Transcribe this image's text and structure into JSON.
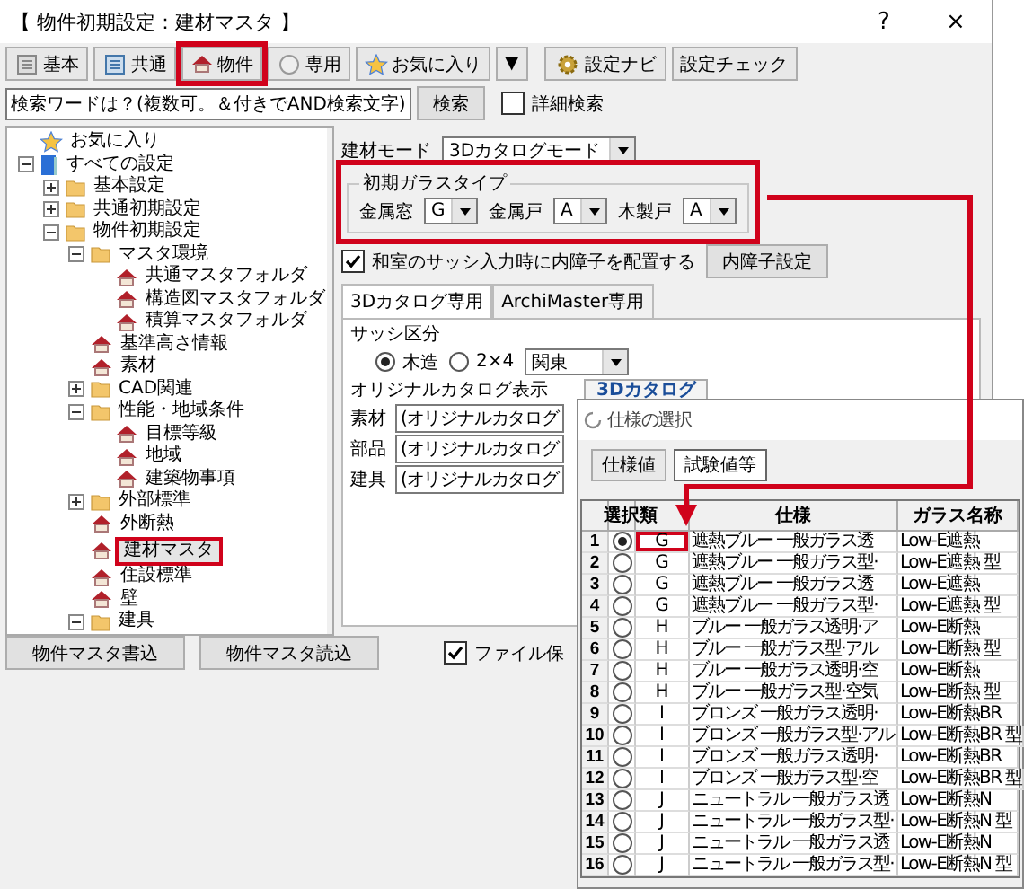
{
  "window": {
    "title": "【 物件初期設定：建材マスタ 】",
    "help": "?",
    "close": "×"
  },
  "toolbar": [
    {
      "label": "基本",
      "kind": "grey-doc",
      "highlighted": false
    },
    {
      "label": "共通",
      "kind": "blue-doc",
      "highlighted": false
    },
    {
      "label": "物件",
      "kind": "house",
      "highlighted": true
    },
    {
      "label": "専用",
      "kind": "circle-doc",
      "highlighted": false
    },
    {
      "label": "お気に入り",
      "kind": "star",
      "highlighted": false
    },
    {
      "label": "▼",
      "kind": "text",
      "highlighted": false
    },
    {
      "label": "設定ナビ",
      "kind": "gear",
      "highlighted": false
    },
    {
      "label": "設定チェック",
      "kind": "text",
      "highlighted": false
    }
  ],
  "search": {
    "value": "検索ワードは？(複数可。＆付きでAND検索文字)",
    "button": "検索",
    "detail": {
      "label": "詳細検索",
      "checked": false
    }
  },
  "tree": [
    {
      "label": "お気に入り",
      "kind": "star",
      "selected": false,
      "highlighted": false
    },
    {
      "label": "すべての設定",
      "kind": "book",
      "expanded": true,
      "selected": false,
      "highlighted": false,
      "children": [
        {
          "label": "基本設定",
          "kind": "folder",
          "expanded": false,
          "selected": false,
          "highlighted": false
        },
        {
          "label": "共通初期設定",
          "kind": "folder",
          "expanded": false,
          "selected": false,
          "highlighted": false
        },
        {
          "label": "物件初期設定",
          "kind": "folder",
          "expanded": true,
          "selected": false,
          "highlighted": false,
          "children": [
            {
              "label": "マスタ環境",
              "kind": "folder",
              "expanded": true,
              "selected": false,
              "highlighted": false,
              "children": [
                {
                  "label": "共通マスタフォルダ",
                  "kind": "house",
                  "selected": false,
                  "highlighted": false
                },
                {
                  "label": "構造図マスタフォルダ",
                  "kind": "house",
                  "selected": false,
                  "highlighted": false
                },
                {
                  "label": "積算マスタフォルダ",
                  "kind": "house",
                  "selected": false,
                  "highlighted": false
                }
              ]
            },
            {
              "label": "基準高さ情報",
              "kind": "house",
              "selected": false,
              "highlighted": false
            },
            {
              "label": "素材",
              "kind": "house",
              "selected": false,
              "highlighted": false
            },
            {
              "label": "CAD関連",
              "kind": "folder",
              "expanded": false,
              "selected": false,
              "highlighted": false
            },
            {
              "label": "性能・地域条件",
              "kind": "folder",
              "expanded": true,
              "selected": false,
              "highlighted": false,
              "children": [
                {
                  "label": "目標等級",
                  "kind": "house",
                  "selected": false,
                  "highlighted": false
                },
                {
                  "label": "地域",
                  "kind": "house",
                  "selected": false,
                  "highlighted": false
                },
                {
                  "label": "建築物事項",
                  "kind": "house",
                  "selected": false,
                  "highlighted": false
                }
              ]
            },
            {
              "label": "外部標準",
              "kind": "folder",
              "expanded": false,
              "selected": false,
              "highlighted": false
            },
            {
              "label": "外断熱",
              "kind": "house",
              "selected": false,
              "highlighted": false
            },
            {
              "label": "建材マスタ",
              "kind": "house",
              "selected": true,
              "highlighted": true
            },
            {
              "label": "住設標準",
              "kind": "house",
              "selected": false,
              "highlighted": false
            },
            {
              "label": "壁",
              "kind": "house",
              "selected": false,
              "highlighted": false
            },
            {
              "label": "建具",
              "kind": "folder",
              "expanded": true,
              "selected": false,
              "highlighted": false
            }
          ]
        }
      ]
    }
  ],
  "form": {
    "mode": {
      "label": "建材モード",
      "value": "3Dカタログモード"
    },
    "glass": {
      "title": "初期ガラスタイプ",
      "highlighted": true,
      "fields": [
        {
          "label": "金属窓",
          "value": "G"
        },
        {
          "label": "金属戸",
          "value": "A"
        },
        {
          "label": "木製戸",
          "value": "A"
        }
      ]
    },
    "inner_shoji": {
      "label": "和室のサッシ入力時に内障子を配置する",
      "checked": true,
      "button": "内障子設定"
    },
    "tabs": [
      {
        "label": "3Dカタログ専用",
        "selected": true
      },
      {
        "label": "ArchiMaster専用",
        "selected": false
      }
    ],
    "sash": {
      "label": "サッシ区分",
      "options": [
        {
          "label": "木造",
          "selected": true
        },
        {
          "label": "2×4",
          "selected": false
        }
      ],
      "region": "関東"
    },
    "catalog": {
      "label": "オリジナルカタログ表示",
      "logo": "3Dカタログ",
      "rows": [
        {
          "label": "素材",
          "value": "(オリジナルカタログ"
        },
        {
          "label": "部品",
          "value": "(オリジナルカタログ"
        },
        {
          "label": "建具",
          "value": "(オリジナルカタログ"
        }
      ]
    }
  },
  "bottom": {
    "buttons": [
      "物件マスタ書込",
      "物件マスタ読込"
    ],
    "save": {
      "label": "ファイル保",
      "checked": true
    }
  },
  "dialog": {
    "title": "仕様の選択",
    "tabs": [
      {
        "label": "仕様値",
        "selected": false
      },
      {
        "label": "試験値等",
        "selected": true
      }
    ],
    "columns": [
      "選択",
      "類",
      "仕様",
      "ガラス名称"
    ],
    "rows": [
      {
        "no": "1",
        "selected": true,
        "type": "G",
        "highlighted": true,
        "spec": "遮熱ブルー 一般ガラス透",
        "glass": "Low-E遮熱"
      },
      {
        "no": "2",
        "selected": false,
        "type": "G",
        "highlighted": false,
        "spec": "遮熱ブルー 一般ガラス型·",
        "glass": "Low-E遮熱 型"
      },
      {
        "no": "3",
        "selected": false,
        "type": "G",
        "highlighted": false,
        "spec": "遮熱ブルー 一般ガラス透",
        "glass": "Low-E遮熱"
      },
      {
        "no": "4",
        "selected": false,
        "type": "G",
        "highlighted": false,
        "spec": "遮熱ブルー 一般ガラス型·",
        "glass": "Low-E遮熱 型"
      },
      {
        "no": "5",
        "selected": false,
        "type": "H",
        "highlighted": false,
        "spec": "ブルー 一般ガラス透明·ア",
        "glass": "Low-E断熱"
      },
      {
        "no": "6",
        "selected": false,
        "type": "H",
        "highlighted": false,
        "spec": "ブルー 一般ガラス型·アル",
        "glass": "Low-E断熱 型"
      },
      {
        "no": "7",
        "selected": false,
        "type": "H",
        "highlighted": false,
        "spec": "ブルー 一般ガラス透明·空",
        "glass": "Low-E断熱"
      },
      {
        "no": "8",
        "selected": false,
        "type": "H",
        "highlighted": false,
        "spec": "ブルー 一般ガラス型·空気",
        "glass": "Low-E断熱 型"
      },
      {
        "no": "9",
        "selected": false,
        "type": "I",
        "highlighted": false,
        "spec": "ブロンズ 一般ガラス透明·",
        "glass": "Low-E断熱BR"
      },
      {
        "no": "10",
        "selected": false,
        "type": "I",
        "highlighted": false,
        "spec": "ブロンズ 一般ガラス型·アル",
        "glass": "Low-E断熱BR 型"
      },
      {
        "no": "11",
        "selected": false,
        "type": "I",
        "highlighted": false,
        "spec": "ブロンズ 一般ガラス透明·",
        "glass": "Low-E断熱BR"
      },
      {
        "no": "12",
        "selected": false,
        "type": "I",
        "highlighted": false,
        "spec": "ブロンズ 一般ガラス型·空",
        "glass": "Low-E断熱BR 型"
      },
      {
        "no": "13",
        "selected": false,
        "type": "J",
        "highlighted": false,
        "spec": "ニュートラル 一般ガラス透",
        "glass": "Low-E断熱N"
      },
      {
        "no": "14",
        "selected": false,
        "type": "J",
        "highlighted": false,
        "spec": "ニュートラル 一般ガラス型·",
        "glass": "Low-E断熱N 型"
      },
      {
        "no": "15",
        "selected": false,
        "type": "J",
        "highlighted": false,
        "spec": "ニュートラル 一般ガラス透",
        "glass": "Low-E断熱N"
      },
      {
        "no": "16",
        "selected": false,
        "type": "J",
        "highlighted": false,
        "spec": "ニュートラル 一般ガラス型·",
        "glass": "Low-E断熱N 型"
      }
    ]
  }
}
